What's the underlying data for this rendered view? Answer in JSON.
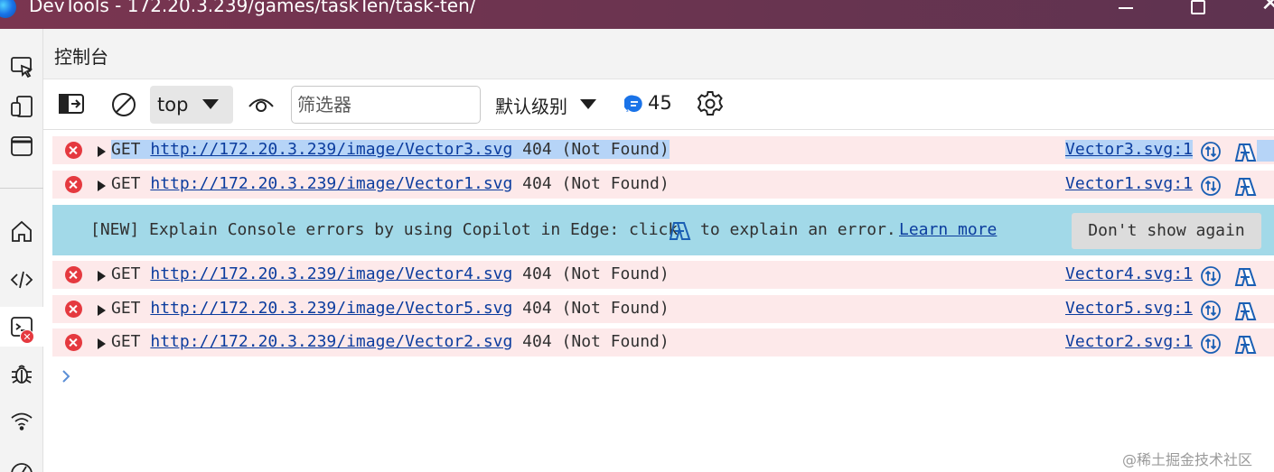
{
  "window": {
    "title": "DevTools - 172.20.3.239/games/taskTen/task-ten/"
  },
  "panel": {
    "title": "控制台"
  },
  "toolbar": {
    "context": "top",
    "filter_placeholder": "筛选器",
    "filter_value": "",
    "levels_label": "默认级别",
    "message_count": "45"
  },
  "rows": [
    {
      "method": "GET",
      "url": "http://172.20.3.239/image/Vector3.svg",
      "status": "404 (Not Found)",
      "source": "Vector3.svg:1"
    },
    {
      "method": "GET",
      "url": "http://172.20.3.239/image/Vector1.svg",
      "status": "404 (Not Found)",
      "source": "Vector1.svg:1"
    },
    {
      "method": "GET",
      "url": "http://172.20.3.239/image/Vector4.svg",
      "status": "404 (Not Found)",
      "source": "Vector4.svg:1"
    },
    {
      "method": "GET",
      "url": "http://172.20.3.239/image/Vector5.svg",
      "status": "404 (Not Found)",
      "source": "Vector5.svg:1"
    },
    {
      "method": "GET",
      "url": "http://172.20.3.239/image/Vector2.svg",
      "status": "404 (Not Found)",
      "source": "Vector2.svg:1"
    }
  ],
  "banner": {
    "text_before": "[NEW] Explain Console errors by using Copilot in Edge: click",
    "text_after": "to explain an error.",
    "learn_more": "Learn more",
    "dismiss": "Don't show again"
  },
  "watermark": "@稀土掘金技术社区",
  "colors": {
    "error_row_bg": "#fde9ea",
    "error_icon": "#e5393f",
    "banner_bg": "#a2d9e8",
    "link": "#0b3c9e",
    "selection": "#b6d4f7"
  }
}
